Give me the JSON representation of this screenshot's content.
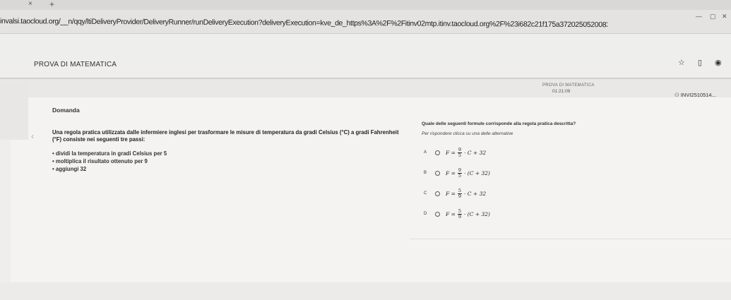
{
  "browser": {
    "url": "invalsi.taocloud.org/__n/qqy/ltiDeliveryProvider/DeliveryRunner/runDeliveryExecution?deliveryExecution=kve_de_https%3A%2F%2Fitinv02mtp.itinv.taocloud.org%2F%23i682c21f175a37202505200832l7e7ad52ee",
    "tab_new": "+",
    "tab_close": "×"
  },
  "app": {
    "title": "PROVA DI MATEMATICA"
  },
  "header": {
    "test_name": "PROVA DI MATEMATICA",
    "timer": "01:21:09",
    "user": "INVI2510514..."
  },
  "question": {
    "section_label": "Domanda",
    "stem": "Una regola pratica utilizzata dalle infermiere inglesi per trasformare le misure di temperatura da gradi Celsius (°C) a gradi Fahrenheit (°F) consiste nei seguenti tre passi:",
    "steps": [
      "dividi la temperatura in gradi Celsius per 5",
      "moltiplica il risultato ottenuto per 9",
      "aggiungi 32"
    ],
    "prompt": "Quale delle seguenti formule corrisponde alla regola pratica descritta?",
    "instruction": "Per rispondere clicca su una delle alternative",
    "choices": [
      {
        "letter": "A",
        "lhs": "F =",
        "num": "9",
        "den": "5",
        "rhs": "· C + 32"
      },
      {
        "letter": "B",
        "lhs": "F =",
        "num": "9",
        "den": "5",
        "rhs": "· (C + 32)"
      },
      {
        "letter": "C",
        "lhs": "F =",
        "num": "5",
        "den": "9",
        "rhs": "· C + 32"
      },
      {
        "letter": "D",
        "lhs": "F =",
        "num": "5",
        "den": "9",
        "rhs": "· (C + 32)"
      }
    ]
  }
}
